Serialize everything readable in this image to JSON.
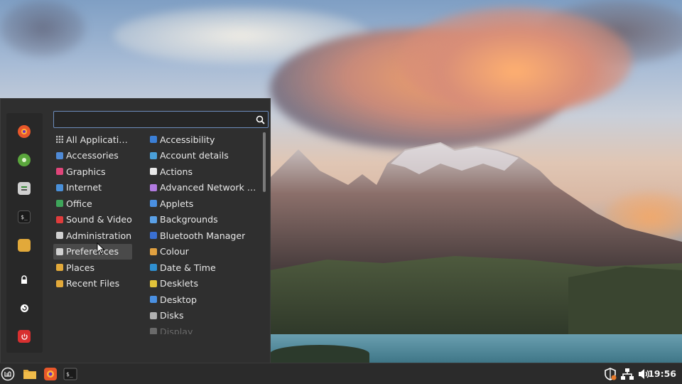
{
  "search": {
    "placeholder": "",
    "value": ""
  },
  "favorites": [
    {
      "name": "firefox-icon",
      "color": "#e8572a"
    },
    {
      "name": "software-manager-icon",
      "color": "#5aa63c"
    },
    {
      "name": "system-settings-icon",
      "color": "#d0d0d0"
    },
    {
      "name": "terminal-icon",
      "color": "#1a1a1a"
    },
    {
      "name": "files-icon",
      "color": "#e2a93a"
    },
    {
      "name": "lock-screen-icon",
      "color": "#ffffff"
    },
    {
      "name": "logout-icon",
      "color": "#ffffff"
    },
    {
      "name": "shutdown-icon",
      "color": "#d83030"
    }
  ],
  "categories": [
    {
      "label": "All Applications",
      "icon": "grid-icon",
      "color": "#9a9a9a"
    },
    {
      "label": "Accessories",
      "icon": "accessories-icon",
      "color": "#4f8ad6"
    },
    {
      "label": "Graphics",
      "icon": "graphics-icon",
      "color": "#e0457a"
    },
    {
      "label": "Internet",
      "icon": "internet-icon",
      "color": "#4a90d9"
    },
    {
      "label": "Office",
      "icon": "office-icon",
      "color": "#3ea55a"
    },
    {
      "label": "Sound & Video",
      "icon": "sound-video-icon",
      "color": "#e03c3c"
    },
    {
      "label": "Administration",
      "icon": "administration-icon",
      "color": "#d0d0d0"
    },
    {
      "label": "Preferences",
      "icon": "preferences-icon",
      "color": "#d0d0d0"
    },
    {
      "label": "Places",
      "icon": "places-folder-icon",
      "color": "#e2a93a"
    },
    {
      "label": "Recent Files",
      "icon": "recent-files-folder-icon",
      "color": "#e2a93a"
    }
  ],
  "selected_category": "Preferences",
  "apps": [
    {
      "label": "Accessibility",
      "icon": "accessibility-icon",
      "color": "#3b7fd6"
    },
    {
      "label": "Account details",
      "icon": "account-details-icon",
      "color": "#4a9fd8"
    },
    {
      "label": "Actions",
      "icon": "actions-icon",
      "color": "#e8e8e8"
    },
    {
      "label": "Advanced Network C...",
      "icon": "network-icon",
      "color": "#b17be0"
    },
    {
      "label": "Applets",
      "icon": "applets-icon",
      "color": "#4a90e2"
    },
    {
      "label": "Backgrounds",
      "icon": "backgrounds-icon",
      "color": "#5aa0e6"
    },
    {
      "label": "Bluetooth Manager",
      "icon": "bluetooth-icon",
      "color": "#3a6fd1"
    },
    {
      "label": "Colour",
      "icon": "colour-icon",
      "color": "#e0a040"
    },
    {
      "label": "Date & Time",
      "icon": "date-time-icon",
      "color": "#2f8fd0"
    },
    {
      "label": "Desklets",
      "icon": "desklets-icon",
      "color": "#e2c33a"
    },
    {
      "label": "Desktop",
      "icon": "desktop-icon",
      "color": "#4a90e2"
    },
    {
      "label": "Disks",
      "icon": "disks-icon",
      "color": "#b0b0b0"
    },
    {
      "label": "Display",
      "icon": "display-icon",
      "color": "#6a6a6a"
    }
  ],
  "taskbar": {
    "launchers": [
      {
        "name": "menu-button-icon"
      },
      {
        "name": "files-launcher-icon"
      },
      {
        "name": "firefox-launcher-icon"
      },
      {
        "name": "terminal-launcher-icon"
      }
    ],
    "tray": [
      {
        "name": "update-manager-shield-icon"
      },
      {
        "name": "network-tray-icon"
      },
      {
        "name": "volume-icon"
      }
    ],
    "clock": "19:56"
  }
}
